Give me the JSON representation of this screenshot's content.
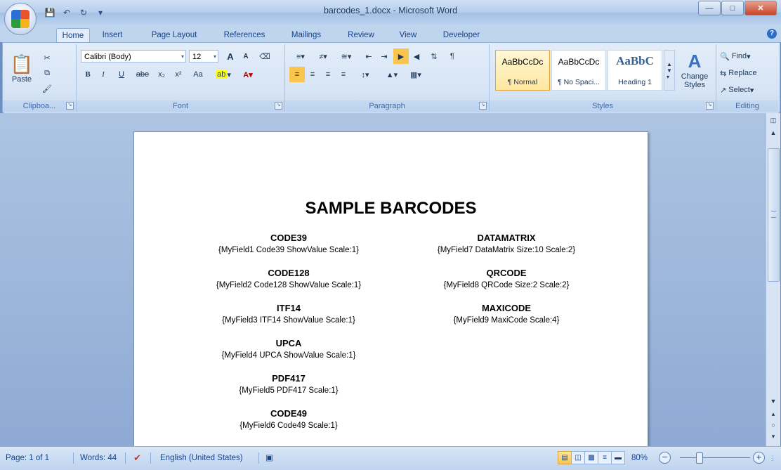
{
  "window": {
    "title": "barcodes_1.docx - Microsoft Word",
    "controls": [
      "minimize",
      "maximize",
      "close"
    ]
  },
  "quick_access": [
    "save-icon",
    "undo-icon",
    "redo-icon",
    "customize-icon"
  ],
  "tabs": [
    "Home",
    "Insert",
    "Page Layout",
    "References",
    "Mailings",
    "Review",
    "View",
    "Developer"
  ],
  "active_tab": "Home",
  "ribbon": {
    "clipboard": {
      "label": "Clipboa...",
      "paste": "Paste"
    },
    "font": {
      "label": "Font",
      "family": "Calibri (Body)",
      "size": "12",
      "bold": "B",
      "italic": "I",
      "underline": "U",
      "strike": "abe",
      "subscript": "x₂",
      "superscript": "x²",
      "case": "Aa",
      "grow": "A",
      "shrink": "A"
    },
    "paragraph": {
      "label": "Paragraph",
      "show_marks": "¶"
    },
    "styles": {
      "label": "Styles",
      "items": [
        {
          "sample": "AaBbCcDc",
          "name": "¶ Normal"
        },
        {
          "sample": "AaBbCcDc",
          "name": "¶ No Spaci..."
        },
        {
          "sample": "AaBbC",
          "name": "Heading 1"
        }
      ],
      "change_styles": "Change Styles"
    },
    "editing": {
      "label": "Editing",
      "find": "Find",
      "replace": "Replace",
      "select": "Select"
    }
  },
  "document": {
    "title": "SAMPLE BARCODES",
    "left_column": [
      {
        "name": "CODE39",
        "field": "{MyField1 Code39 ShowValue Scale:1}"
      },
      {
        "name": "CODE128",
        "field": "{MyField2 Code128 ShowValue Scale:1}"
      },
      {
        "name": "ITF14",
        "field": "{MyField3 ITF14 ShowValue Scale:1}"
      },
      {
        "name": "UPCA",
        "field": "{MyField4 UPCA ShowValue Scale:1}"
      },
      {
        "name": "PDF417",
        "field": "{MyField5 PDF417 Scale:1}"
      },
      {
        "name": "CODE49",
        "field": "{MyField6 Code49 Scale:1}"
      }
    ],
    "right_column": [
      {
        "name": "DATAMATRIX",
        "field": "{MyField7 DataMatrix Size:10 Scale:2}"
      },
      {
        "name": "QRCODE",
        "field": "{MyField8 QRCode Size:2 Scale:2}"
      },
      {
        "name": "MAXICODE",
        "field": "{MyField9 MaxiCode Scale:4}"
      }
    ]
  },
  "status": {
    "page": "Page: 1 of 1",
    "words": "Words: 44",
    "language": "English (United States)",
    "zoom": "80%"
  }
}
